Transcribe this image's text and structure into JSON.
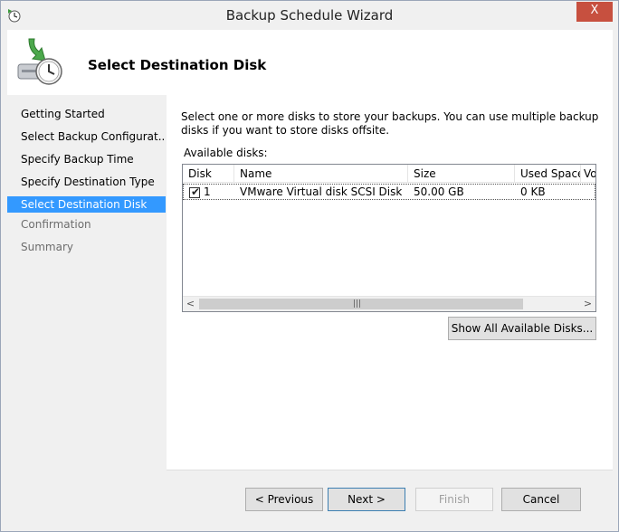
{
  "window": {
    "title": "Backup Schedule Wizard",
    "close_label": "X"
  },
  "header": {
    "heading": "Select Destination Disk"
  },
  "nav": {
    "items": [
      {
        "label": "Getting Started",
        "state": "normal"
      },
      {
        "label": "Select Backup Configurat...",
        "state": "normal"
      },
      {
        "label": "Specify Backup Time",
        "state": "normal"
      },
      {
        "label": "Specify Destination Type",
        "state": "normal"
      },
      {
        "label": "Select Destination Disk",
        "state": "active"
      },
      {
        "label": "Confirmation",
        "state": "disabled"
      },
      {
        "label": "Summary",
        "state": "disabled"
      }
    ]
  },
  "content": {
    "description": "Select one or more disks to store your backups. You can use multiple backup disks if you want to store disks offsite.",
    "available_label": "Available disks:",
    "columns": [
      "Disk",
      "Name",
      "Size",
      "Used Space",
      "Vo"
    ],
    "rows": [
      {
        "checked": true,
        "disk": "1",
        "name": "VMware Virtual disk SCSI Disk D...",
        "size": "50.00 GB",
        "used": "0 KB",
        "vol": ""
      }
    ],
    "show_all_label": "Show All Available Disks..."
  },
  "footer": {
    "previous_label": "< Previous",
    "next_label": "Next >",
    "finish_label": "Finish",
    "cancel_label": "Cancel"
  },
  "colors": {
    "accent": "#3399ff",
    "close": "#c7503f"
  }
}
